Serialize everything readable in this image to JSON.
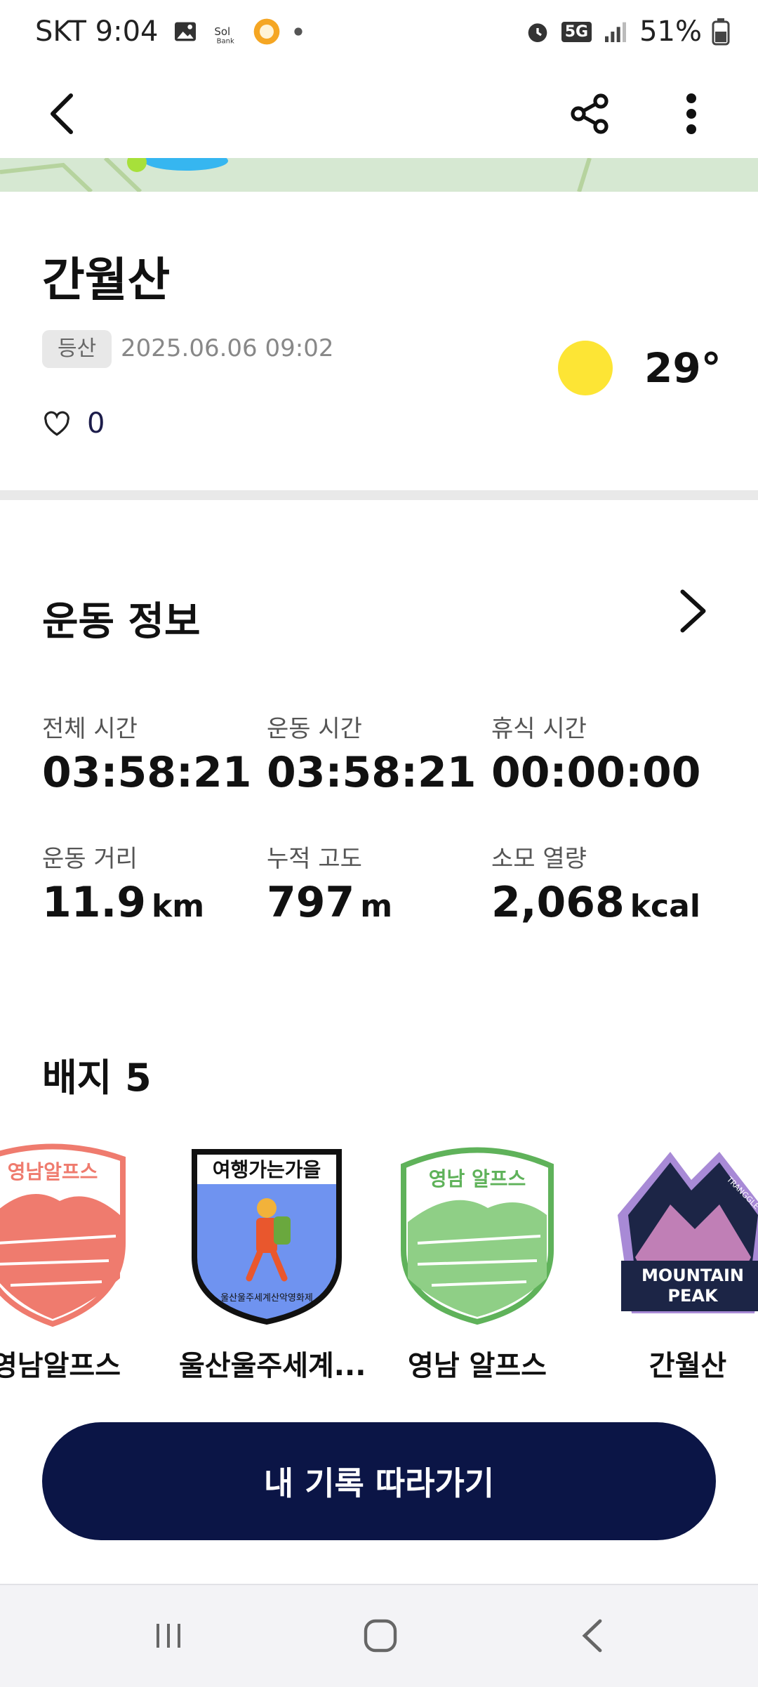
{
  "status_bar": {
    "carrier_time": "SKT 9:04",
    "battery": "51%",
    "network": "5G"
  },
  "header": {
    "back_icon": "chevron-left-icon",
    "share_icon": "share-icon",
    "menu_icon": "more-vertical-icon"
  },
  "record": {
    "title": "간월산",
    "tag": "등산",
    "datetime": "2025.06.06 09:02",
    "temperature": "29°",
    "weather_icon": "sun-icon",
    "like_count": "0"
  },
  "exercise": {
    "title": "운동 정보",
    "stats": [
      {
        "label": "전체 시간",
        "value": "03:58:21",
        "unit": ""
      },
      {
        "label": "운동 시간",
        "value": "03:58:21",
        "unit": ""
      },
      {
        "label": "휴식 시간",
        "value": "00:00:00",
        "unit": ""
      },
      {
        "label": "운동 거리",
        "value": "11.9",
        "unit": "km"
      },
      {
        "label": "누적 고도",
        "value": "797",
        "unit": "m"
      },
      {
        "label": "소모 열량",
        "value": "2,068",
        "unit": "kcal"
      }
    ]
  },
  "badges": {
    "title": "배지 5",
    "items": [
      {
        "name": "영남알프스",
        "art_text": "영남알프스",
        "color": "#ef7b6e"
      },
      {
        "name": "울산울주세계...",
        "art_text": "여행가는가을",
        "sub_text": "울산울주세계산악영화제",
        "color": "#6f93f0"
      },
      {
        "name": "영남 알프스",
        "art_text": "영남 알프스",
        "color": "#5fb25a"
      },
      {
        "name": "간월산",
        "art_text": "MOUNTAIN PEAK",
        "sub_text": "TRANGGLE",
        "color": "#a88ad6"
      }
    ]
  },
  "cta": {
    "label": "내 기록 따라가기"
  },
  "colors": {
    "accent": "#0b1546",
    "sun": "#fde535"
  }
}
